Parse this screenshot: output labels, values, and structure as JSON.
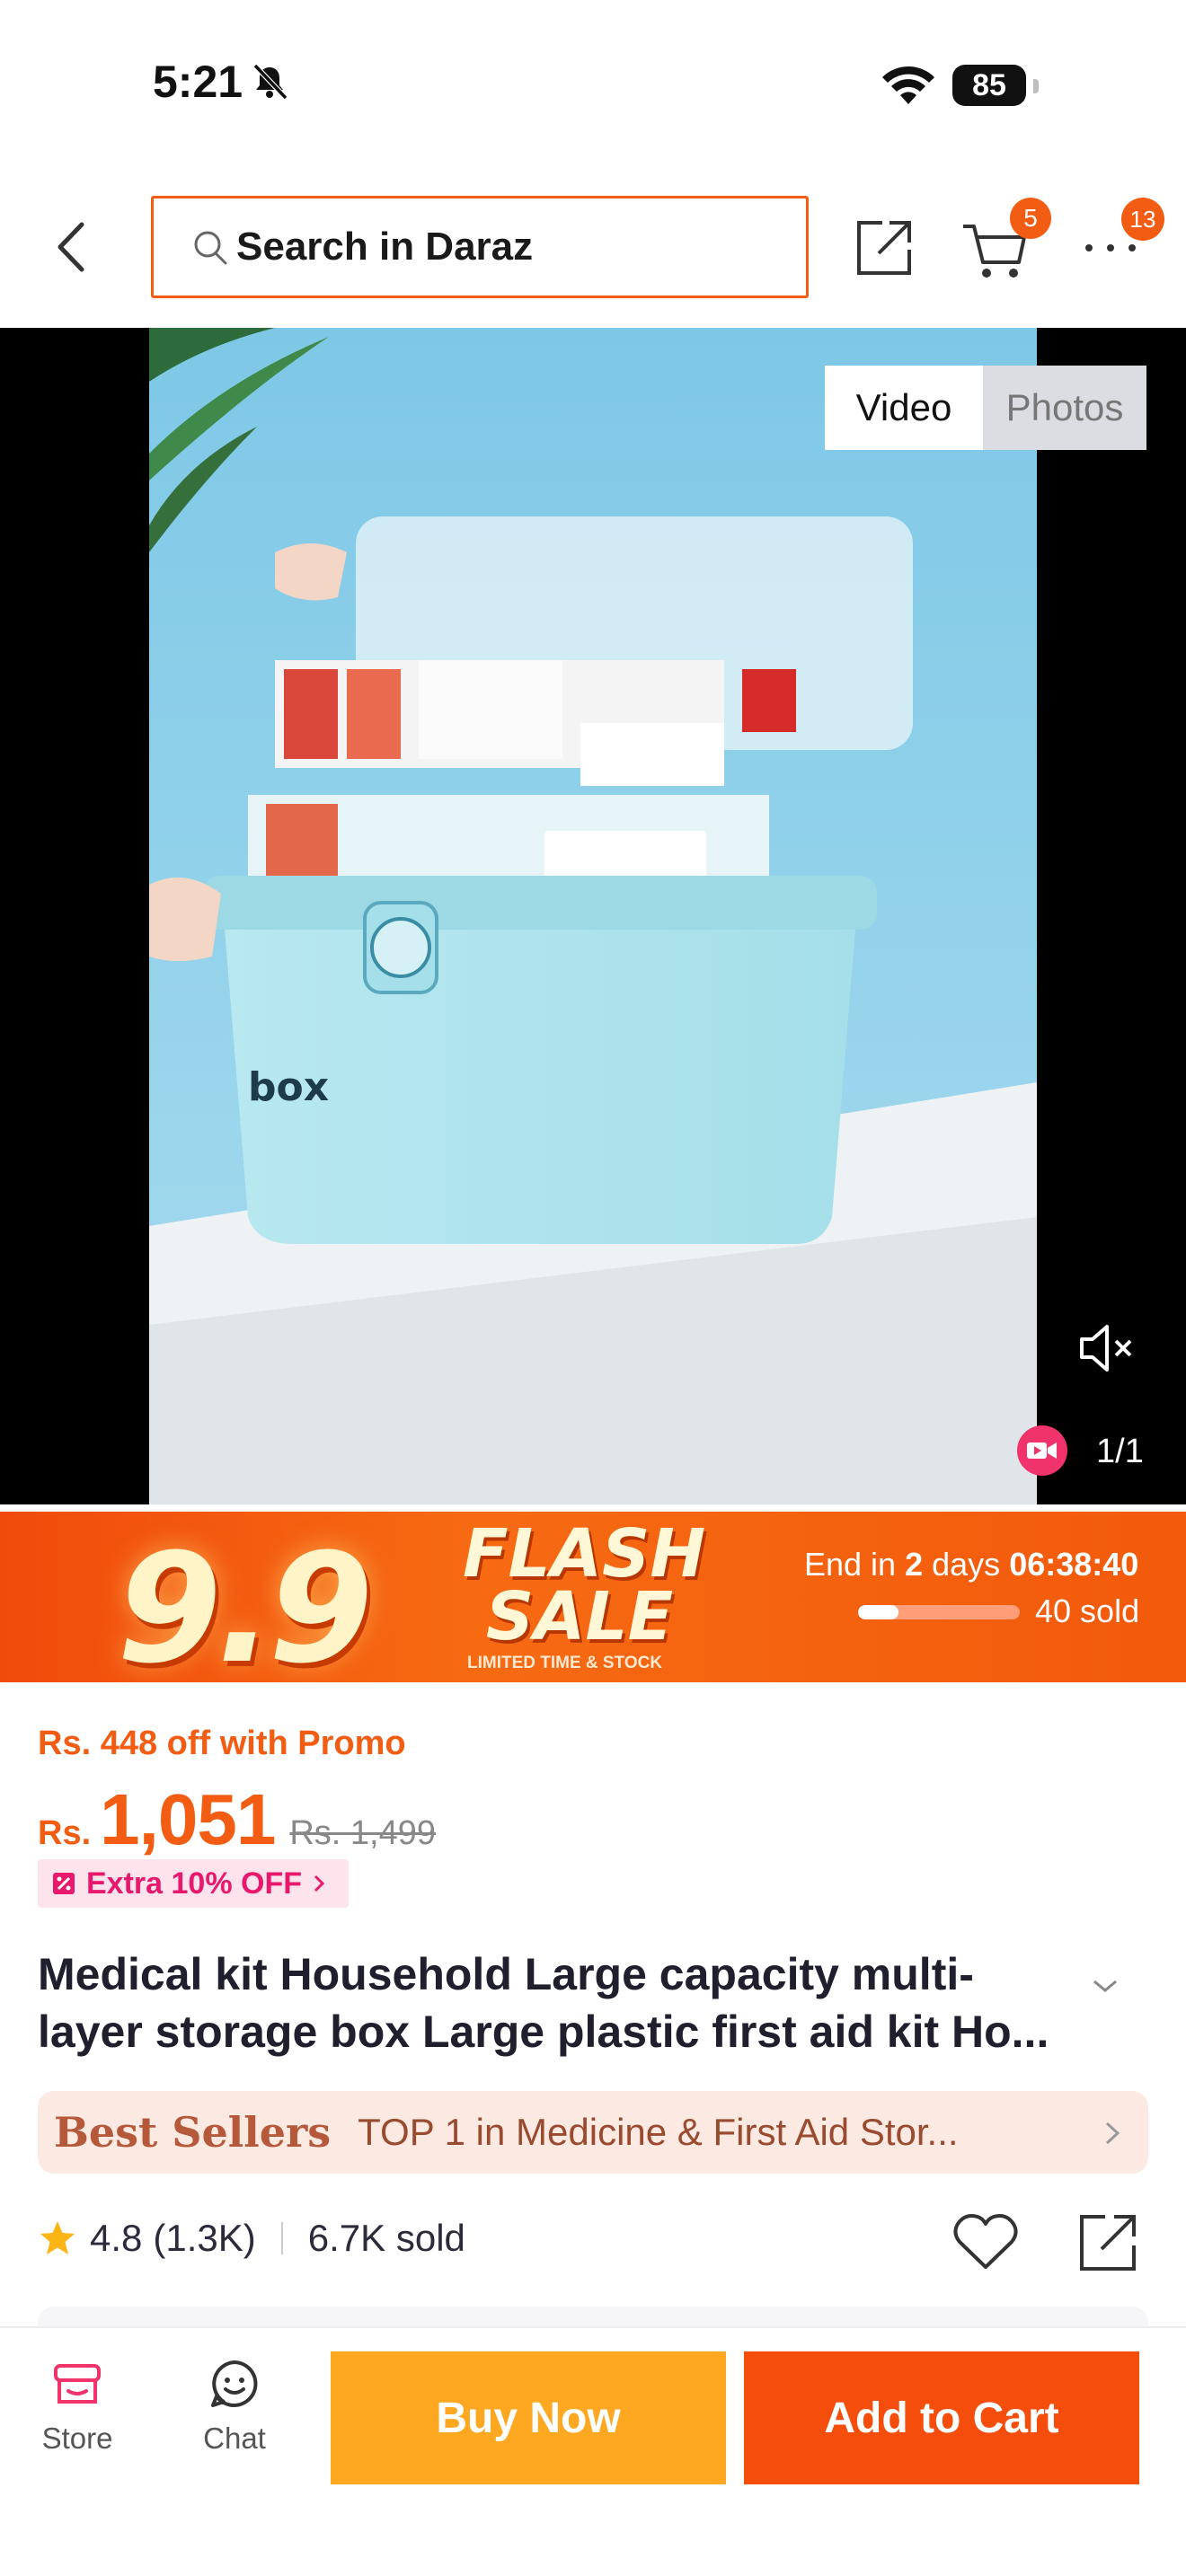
{
  "status_bar": {
    "time": "5:21",
    "battery": "85"
  },
  "header": {
    "search_placeholder": "Search in Daraz",
    "cart_count": "5",
    "more_count": "13"
  },
  "media": {
    "tab_video": "Video",
    "tab_photos": "Photos",
    "selected_tab": "Video",
    "counter": "1/1",
    "product_label": "box"
  },
  "flash_sale": {
    "event_number": "9.9",
    "title": "FLASH SALE",
    "subtitle": "LIMITED TIME & STOCK",
    "end_prefix": "End in",
    "end_days": "2",
    "end_days_label": "days",
    "countdown": "06:38:40",
    "sold_text": "40 sold",
    "progress_fraction": 0.25
  },
  "pricing": {
    "promo_text": "Rs. 448 off with Promo",
    "currency": "Rs.",
    "price": "1,051",
    "original_price": "Rs. 1,499",
    "extra_offer": "Extra 10% OFF"
  },
  "product": {
    "title": "Medical kit Household Large capacity multi-layer storage box Large plastic first aid kit Ho..."
  },
  "best_sellers": {
    "label": "Best Sellers",
    "text": "TOP 1 in Medicine & First Aid Stor..."
  },
  "rating": {
    "score": "4.8",
    "count": "(1.3K)",
    "sold": "6.7K sold"
  },
  "bottom_bar": {
    "store_label": "Store",
    "chat_label": "Chat",
    "buy_now": "Buy Now",
    "add_to_cart": "Add to Cart"
  },
  "colors": {
    "accent": "#f35d13",
    "buy_now": "#fea721",
    "add_to_cart": "#f54d0b",
    "extra_pink": "#e8186d"
  }
}
